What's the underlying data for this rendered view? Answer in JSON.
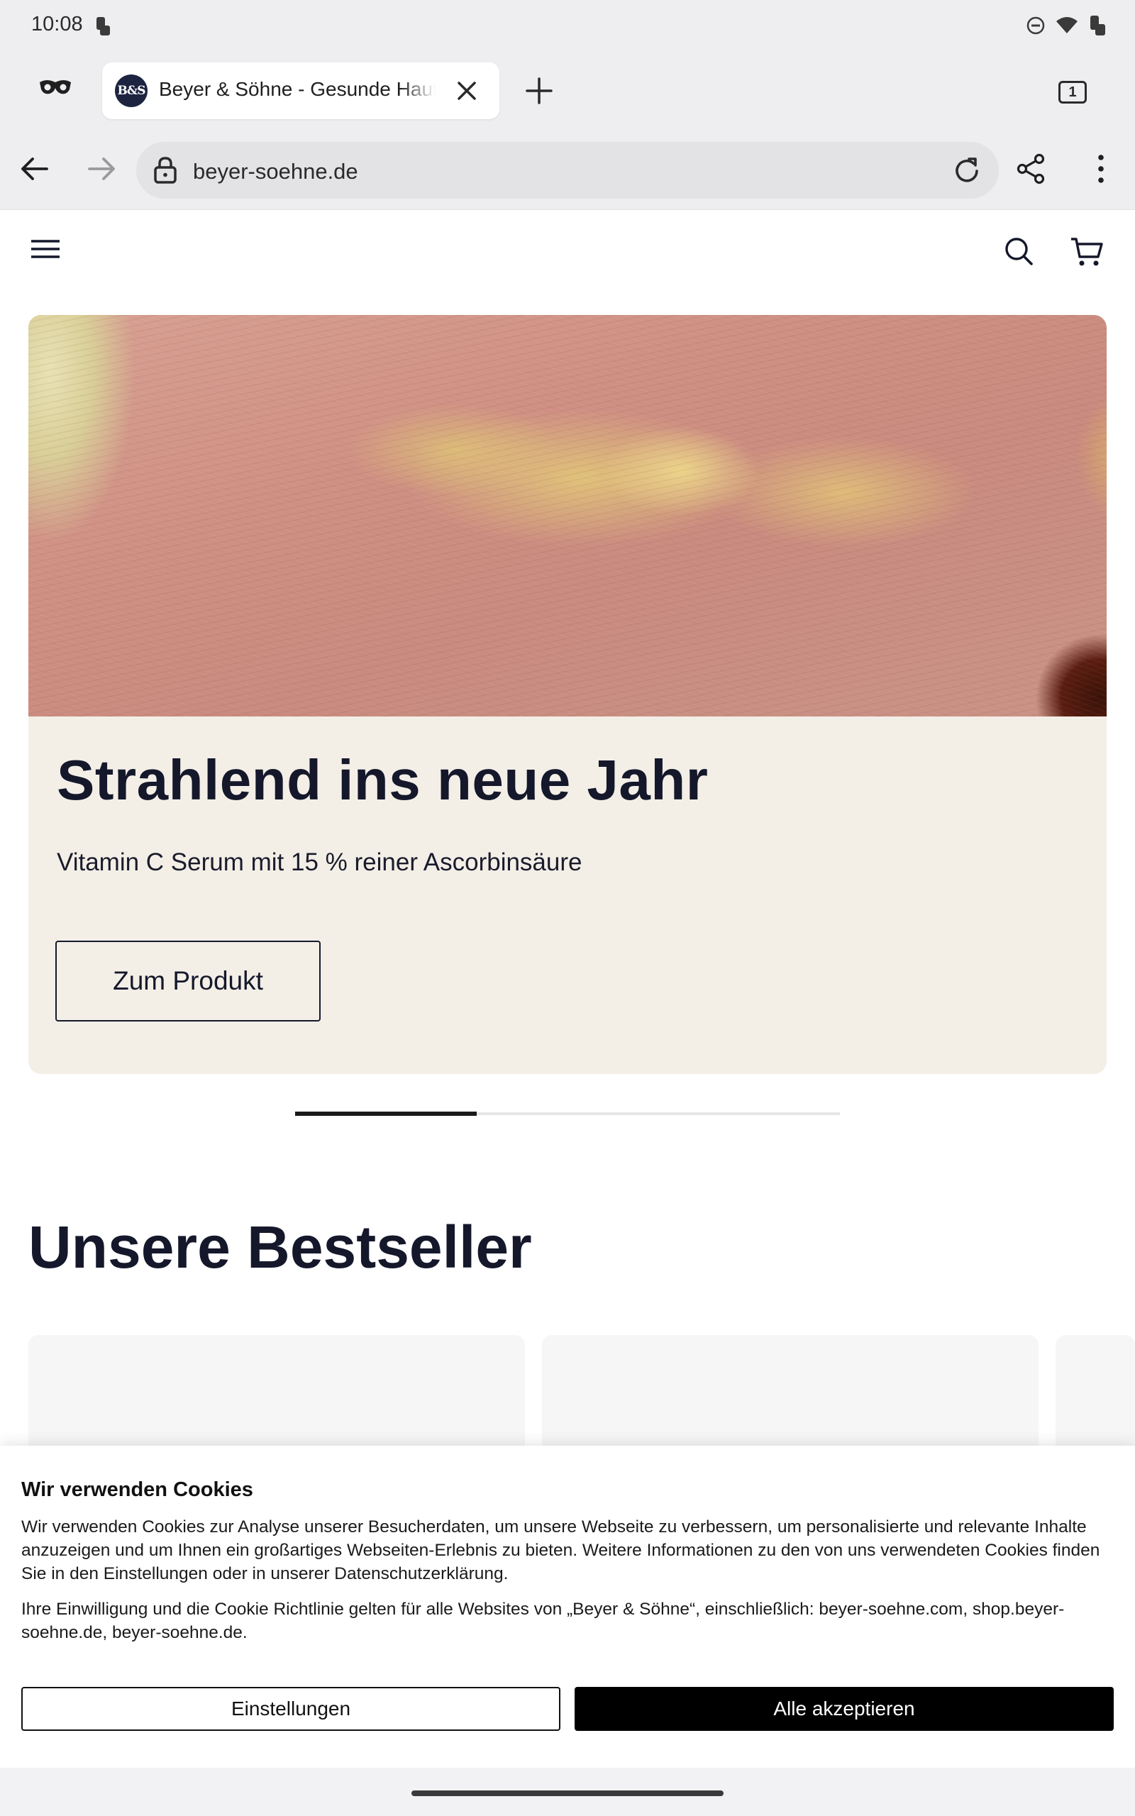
{
  "status_bar": {
    "time": "10:08",
    "icons": [
      "notification-app-icon",
      "do-not-disturb-icon",
      "wifi-icon",
      "battery-icon"
    ]
  },
  "browser": {
    "tab": {
      "favicon_text": "B&S",
      "title": "Beyer & Söhne - Gesunde Haut"
    },
    "tab_count": "1",
    "url": "beyer-soehne.de"
  },
  "hero": {
    "title": "Strahlend ins neue Jahr",
    "subtitle": "Vitamin C Serum mit 15 % reiner Ascorbinsäure",
    "cta_label": "Zum Produkt",
    "carousel": {
      "current": 1,
      "total": 3
    }
  },
  "bestsellers": {
    "title": "Unsere Bestseller"
  },
  "cookie_banner": {
    "title": "Wir verwenden Cookies",
    "text_1": "Wir verwenden Cookies zur Analyse unserer Besucherdaten, um unsere Webseite zu verbessern, um personalisierte und relevante Inhalte anzuzeigen und um Ihnen ein großartiges Webseiten-Erlebnis zu bieten. Weitere Informationen zu den von uns verwendeten Cookies finden Sie in den Einstellungen oder in unserer Datenschutzerklärung.",
    "text_2": "Ihre Einwilligung und die Cookie Richtlinie gelten für alle Websites von „Beyer & Söhne“, einschließlich: beyer-soehne.com, shop.beyer-soehne.de, beyer-soehne.de.",
    "settings_label": "Einstellungen",
    "accept_label": "Alle akzeptieren"
  },
  "colors": {
    "brand_navy": "#15182b",
    "hero_panel": "#f3efe7",
    "browser_chrome": "#eeeef0",
    "accept_button": "#000000"
  }
}
